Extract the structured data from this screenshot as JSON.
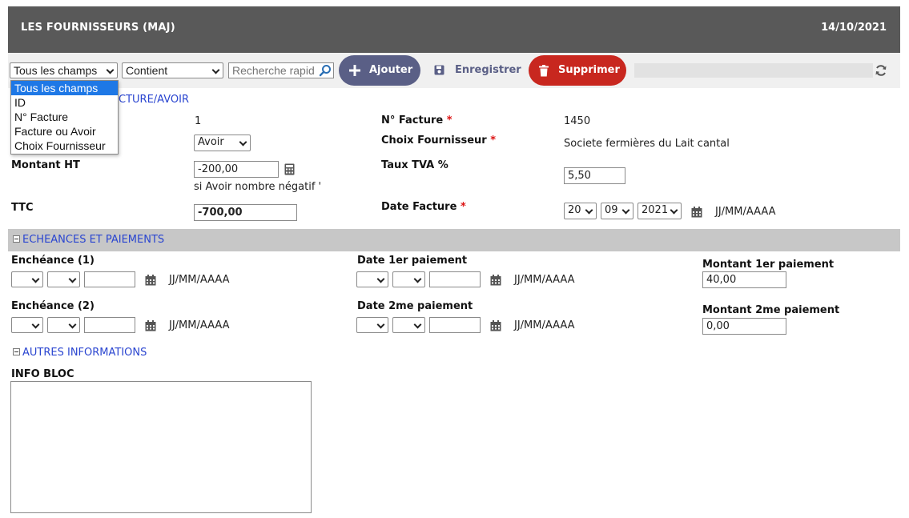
{
  "header": {
    "title": "LES FOURNISSEURS (MAJ)",
    "date": "14/10/2021"
  },
  "toolbar": {
    "field_select": "Tous les champs",
    "operator_select": "Contient",
    "search_placeholder": "Recherche rapid",
    "add_label": "Ajouter",
    "save_label": "Enregistrer",
    "delete_label": "Supprimer"
  },
  "field_dropdown": {
    "options": [
      "Tous les champs",
      "ID",
      "N° Facture",
      "Facture ou Avoir",
      "Choix Fournisseur"
    ],
    "selected_index": 0
  },
  "section_facture": {
    "title_visible": "CTURE/AVOIR",
    "id_value": "1",
    "type_value": "Avoir",
    "montant_ht_label": "Montant HT",
    "montant_ht_value": "-200,00",
    "montant_hint": "si Avoir nombre négatif '",
    "ttc_label": "TTC",
    "ttc_value": "-700,00",
    "num_facture_label": "N° Facture",
    "num_facture_value": "1450",
    "fournisseur_label": "Choix Fournisseur",
    "fournisseur_value": "Societe fermières du Lait cantal",
    "tva_label": "Taux TVA %",
    "tva_value": "5,50",
    "date_facture_label": "Date Facture",
    "date_day": "20",
    "date_month": "09",
    "date_year": "2021",
    "date_format": "JJ/MM/AAAA",
    "required_mark": "*"
  },
  "section_echeances": {
    "title": "ECHEANCES ET PAIEMENTS",
    "echeance1_label": "Enchéance (1)",
    "echeance2_label": "Enchéance (2)",
    "date1_label": "Date 1er paiement",
    "date2_label": "Date 2me paiement",
    "montant1_label": "Montant 1er paiement",
    "montant1_value": "40,00",
    "montant2_label": "Montant 2me paiement",
    "montant2_value": "0,00",
    "date_format": "JJ/MM/AAAA"
  },
  "section_autres": {
    "title": "AUTRES INFORMATIONS",
    "info_label": "INFO BLOC"
  },
  "colors": {
    "header_bg": "#595959",
    "accent_blue": "#5a5f86",
    "delete_red": "#c8271f",
    "section_band": "#c7c7c7",
    "link_blue": "#2a45d0",
    "required_red": "#dd1111"
  }
}
